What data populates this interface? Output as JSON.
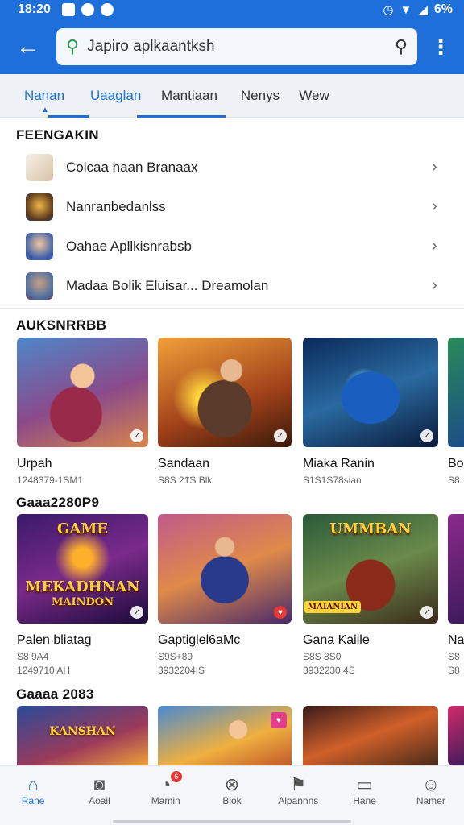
{
  "status": {
    "time": "18:20",
    "battery": "6%"
  },
  "search": {
    "query": "Japiro aplkaantksh"
  },
  "tabs": [
    "Nanan",
    "Uaaglan",
    "Mantiaan",
    "Nenys",
    "Wew"
  ],
  "sections": {
    "recent_title": "FEENGAKIN",
    "featured_title": "AUKSNRRBB",
    "games_title": "Gaaa2280P9",
    "games2_title": "Gaaaa 2083"
  },
  "recent": [
    {
      "label": "Colcaa haan Branaax"
    },
    {
      "label": "Nanranbedanlss"
    },
    {
      "label": "Oahae Apllkisnrabsb"
    },
    {
      "label": "Madaa Bolik Eluisar... Dreamolan"
    }
  ],
  "featured": [
    {
      "title": "Urpah",
      "meta": "1248379-1SM1"
    },
    {
      "title": "Sandaan",
      "meta": "S8S 21̈S Blk"
    },
    {
      "title": "Miaka Ranin",
      "meta": "S1S1S78sian"
    },
    {
      "title": "Bo",
      "meta": "S8"
    }
  ],
  "games": [
    {
      "title": "Palen bliatag",
      "meta": "S8 9A4",
      "meta2": "1249710 AH",
      "art_text_1": "GAME",
      "art_text_2": "MEKADHNAN",
      "art_text_3": "MAINDON"
    },
    {
      "title": "Gaptiglel6aMc",
      "meta": "S9S+89",
      "meta2": "3932204IS"
    },
    {
      "title": "Gana Kaille",
      "meta": "S8S 8S0",
      "meta2": "3932230 4S",
      "art_text_1": "UMMBAN",
      "art_text_2": "MAIANIAN"
    },
    {
      "title": "Na",
      "meta": "S8",
      "meta2": "S8"
    }
  ],
  "games2": [
    {
      "art_text": "KANSHAN"
    },
    {
      "art_text": ""
    },
    {
      "art_text": ""
    },
    {
      "art_text": ""
    }
  ],
  "nav": [
    {
      "label": "Rane"
    },
    {
      "label": "Aoail"
    },
    {
      "label": "Mamin",
      "badge": "6"
    },
    {
      "label": "Biok"
    },
    {
      "label": "Alpannns"
    },
    {
      "label": "Hane"
    },
    {
      "label": "Namer"
    }
  ],
  "colors": {
    "primary": "#1e6fd9",
    "badge_red": "#e53935"
  }
}
